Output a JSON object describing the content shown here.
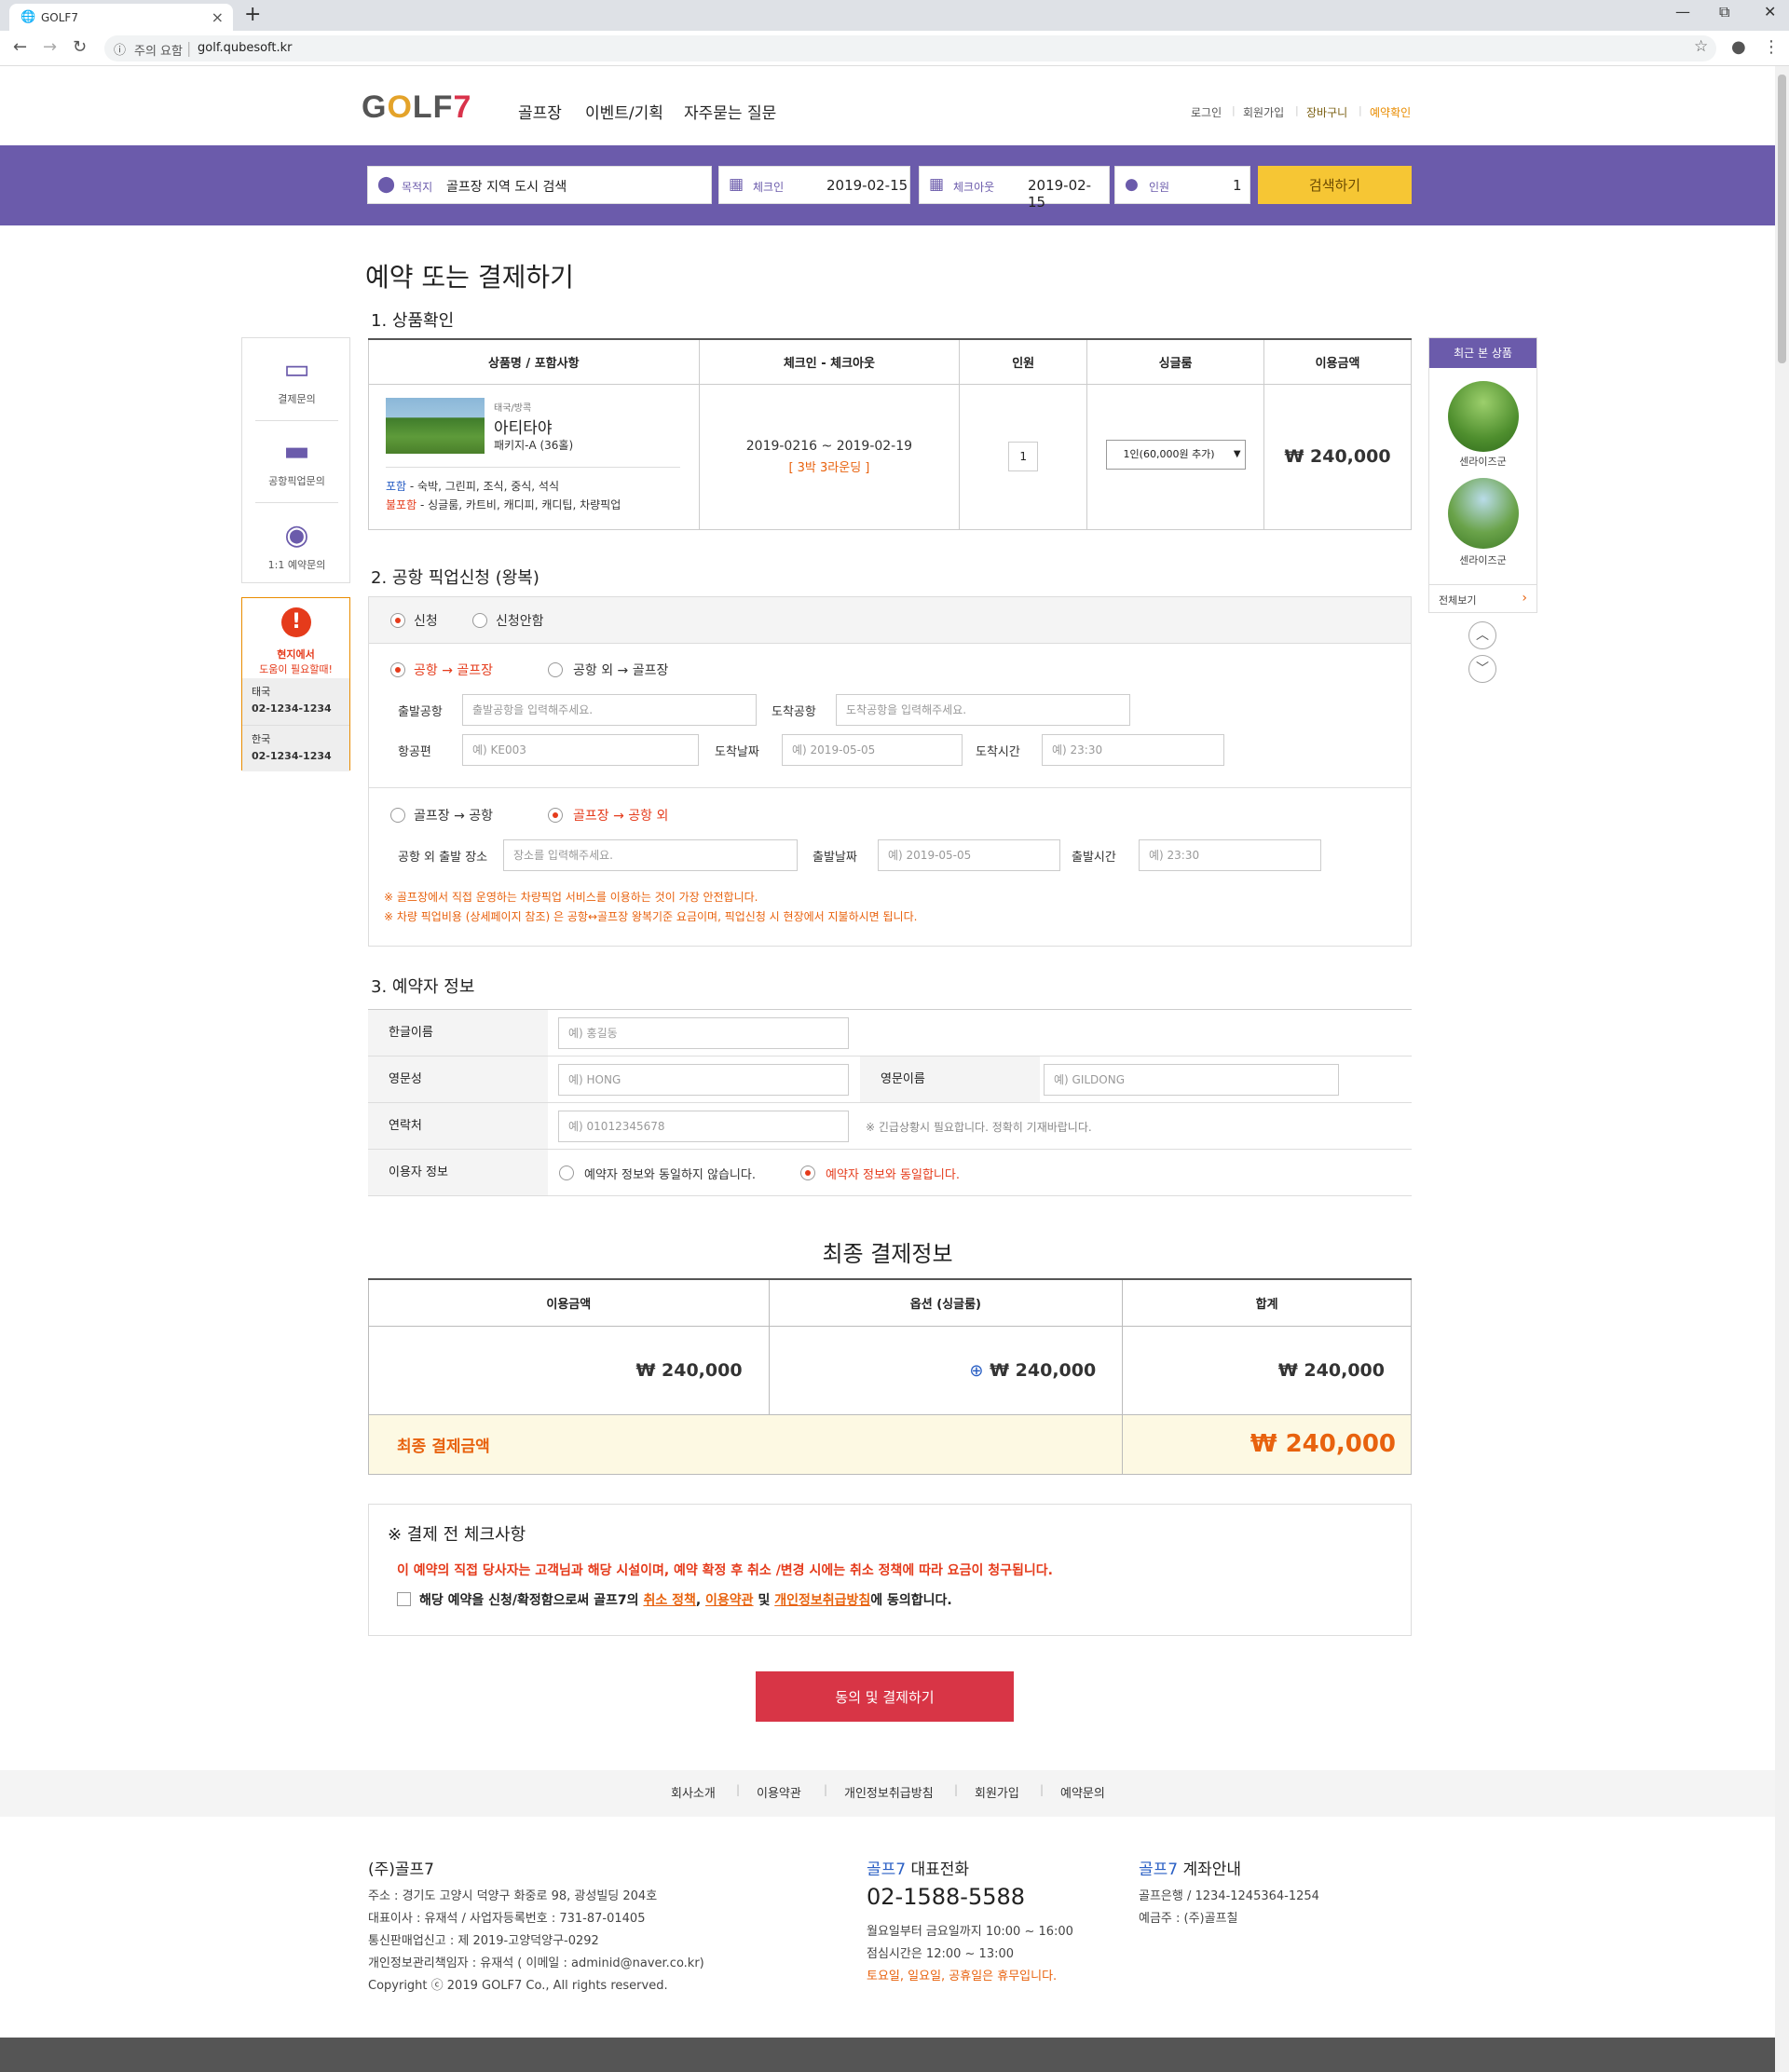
{
  "browser": {
    "tab_title": "GOLF7",
    "tab_close": "×",
    "new_tab": "+",
    "win_min": "—",
    "win_restore": "⧉",
    "win_close": "✕",
    "security": "주의 요함",
    "url": "golf.qubesoft.kr"
  },
  "header": {
    "logo": {
      "g": "G",
      "o": "O",
      "lf": "LF",
      "n": "7"
    },
    "gnb": [
      "골프장",
      "이벤트/기획",
      "자주묻는 질문"
    ],
    "user_nav": [
      "로그인",
      "회원가입",
      "장바구니",
      "예약확인"
    ]
  },
  "search": {
    "dest_label": "목적지",
    "dest_value": "골프장 지역 도시 검색",
    "checkin_label": "체크인",
    "checkin_value": "2019-02-15",
    "checkout_label": "체크아웃",
    "checkout_value": "2019-02-15",
    "people_label": "인원",
    "people_value": "1",
    "search_button": "검색하기"
  },
  "page_title": "예약 또는 결제하기",
  "section1": {
    "title": "1. 상품확인",
    "headers": [
      "상품명 / 포함사항",
      "체크인 - 체크아웃",
      "인원",
      "싱글룸",
      "이용금액"
    ],
    "product": {
      "region": "태국/방콕",
      "name": "아티타야",
      "package": "패키지-A (36홀)",
      "include_label": "포함",
      "include_text": " - 숙박, 그린피, 조식, 중식, 석식",
      "exclude_label": "불포함",
      "exclude_text": " - 싱글룸, 카트비, 캐디피, 캐디팁, 차량픽업"
    },
    "dates": "2019-0216 ~ 2019-02-19",
    "rounds": "[ 3박 3라운딩 ]",
    "people": "1",
    "single_room": "1인(60,000원 추가)",
    "price": "₩ 240,000"
  },
  "section2": {
    "title": "2. 공항 픽업신청 (왕복)",
    "apply": "신청",
    "no_apply": "신청안함",
    "route1": "공항 → 골프장",
    "route2": "공항 외 → 골프장",
    "depart_airport_label": "출발공항",
    "depart_airport_ph": "출발공항을 입력해주세요.",
    "arrive_airport_label": "도착공항",
    "arrive_airport_ph": "도착공항을 입력해주세요.",
    "flight_label": "항공편",
    "flight_ph": "예) KE003",
    "arrive_date_label": "도착날짜",
    "arrive_date_ph": "예) 2019-05-05",
    "arrive_time_label": "도착시간",
    "arrive_time_ph": "예) 23:30",
    "route3": "골프장 → 공항",
    "route4": "골프장 → 공항 외",
    "depart_place_label": "공항 외 출발 장소",
    "depart_place_ph": "장소를 입력해주세요.",
    "depart_date_label": "출발날짜",
    "depart_date_ph": "예) 2019-05-05",
    "depart_time_label": "출발시간",
    "depart_time_ph": "예) 23:30",
    "note1": "※ 골프장에서 직접 운영하는 차량픽업 서비스를 이용하는 것이 가장 안전합니다.",
    "note2": "※ 차량 픽업비용 (상세페이지 참조) 은 공항↔골프장 왕복기준 요금이며, 픽업신청 시 현장에서 지불하시면 됩니다."
  },
  "section3": {
    "title": "3. 예약자 정보",
    "korean_name_label": "한글이름",
    "korean_name_ph": "예) 홍길동",
    "last_name_label": "영문성",
    "last_name_ph": "예) HONG",
    "first_name_label": "영문이름",
    "first_name_ph": "예) GILDONG",
    "contact_label": "연락처",
    "contact_ph": "예) 01012345678",
    "contact_note": "※ 긴급상황시 필요합니다. 정확히 기재바랍니다.",
    "user_info_label": "이용자 정보",
    "user_diff": "예약자 정보와 동일하지 않습니다.",
    "user_same": "예약자 정보와 동일합니다."
  },
  "final": {
    "title": "최종 결제정보",
    "headers": [
      "이용금액",
      "옵션 (싱글룸)",
      "합계"
    ],
    "amount": "₩ 240,000",
    "option": "₩ 240,000",
    "option_icon": "⊕",
    "sum": "₩ 240,000",
    "total_label": "최종 결제금액",
    "total_value": "₩ 240,000"
  },
  "checklist": {
    "title": "※ 결제 전 체크사항",
    "warning": "이 예약의 직접 당사자는 고객님과 해당 시설이며, 예약 확정 후 취소 /변경 시에는 취소 정책에 따라 요금이 청구됩니다.",
    "agree_pre": "해당 예약을 신청/확정함으로써 골프7의 ",
    "link1": "취소 정책",
    "comma": ", ",
    "link2": "이용약관",
    "and": " 및 ",
    "link3": "개인정보취급방침",
    "agree_post": "에 동의합니다."
  },
  "pay_button": "동의 및 결제하기",
  "quick_menu": {
    "items": [
      "결제문의",
      "공항픽업문의",
      "1:1 예약문의"
    ],
    "help_title1": "현지에서",
    "help_title2": "도움이 필요할때!",
    "thai_label": "태국",
    "thai_phone": "02-1234-1234",
    "korea_label": "한국",
    "korea_phone": "02-1234-1234"
  },
  "recent": {
    "title": "최근 본 상품",
    "items": [
      "센라이즈군",
      "센라이즈군"
    ],
    "view_all": "전체보기",
    "view_all_arrow": "›"
  },
  "footer": {
    "links": [
      "회사소개",
      "이용약관",
      "개인정보취급방침",
      "회원가입",
      "예약문의"
    ],
    "company": "(주)골프7",
    "address": "주소 : 경기도 고양시 덕양구 화중로 98, 광성빌딩 204호",
    "ceo": "대표이사 : 유재석  /  사업자등록번호 : 731-87-01405",
    "mail_order": "통신판매업신고 : 제 2019-고양덕양구-0292",
    "privacy_officer": "개인정보관리책임자 : 유재석 ( 이메일 : adminid@naver.co.kr)",
    "copyright": "Copyright ⓒ 2019 GOLF7 Co., All rights reserved.",
    "phone_brand": "골프7",
    "phone_title": " 대표전화",
    "phone": "02-1588-5588",
    "hours1": "월요일부터 금요일까지 10:00 ~ 16:00",
    "hours2": "점심시간은 12:00 ~ 13:00",
    "hours3": "토요일, 일요일, 공휴일은 휴무입니다.",
    "bank_brand": "골프7",
    "bank_title": " 계좌안내",
    "bank": "골프은행  /  1234-1245364-1254",
    "holder": "예금주 : (주)골프칠"
  }
}
